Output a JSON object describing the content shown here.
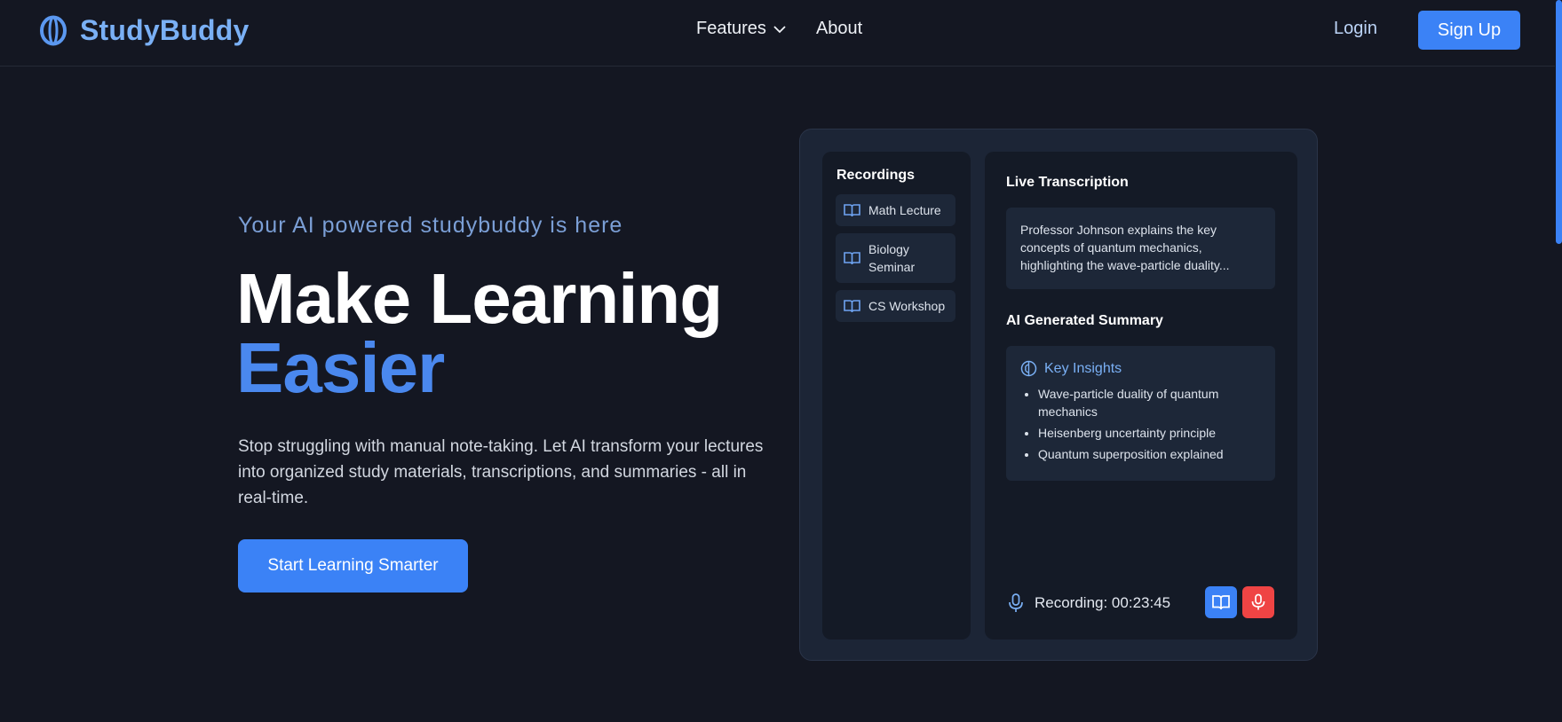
{
  "nav": {
    "brand": "StudyBuddy",
    "features": "Features",
    "about": "About",
    "login": "Login",
    "signup": "Sign Up"
  },
  "hero": {
    "tagline": "Your AI powered studybuddy is here",
    "headline_line1": "Make Learning",
    "headline_line2": "Easier",
    "description": "Stop struggling with manual note-taking. Let AI transform your lectures into organized study materials, transcriptions, and summaries - all in real-time.",
    "cta": "Start Learning Smarter"
  },
  "mock": {
    "recordings_title": "Recordings",
    "recordings": [
      {
        "label": "Math Lecture"
      },
      {
        "label": "Biology Seminar"
      },
      {
        "label": "CS Workshop"
      }
    ],
    "live_title": "Live Transcription",
    "transcription": "Professor Johnson explains the key concepts of quantum mechanics, highlighting the wave-particle duality...",
    "summary_title": "AI Generated Summary",
    "insights_title": "Key Insights",
    "insights": [
      "Wave-particle duality of quantum mechanics",
      "Heisenberg uncertainty principle",
      "Quantum superposition explained"
    ],
    "recording_status": "Recording: 00:23:45"
  },
  "colors": {
    "background": "#141722",
    "accent": "#3b82f6",
    "brand": "#7ab0f5",
    "record": "#ef4444"
  },
  "icons": {
    "brand": "logo-icon",
    "dropdown": "chevron-down-icon",
    "recording_item": "book-open-icon",
    "insights": "brain-icon",
    "mic": "mic-icon"
  }
}
